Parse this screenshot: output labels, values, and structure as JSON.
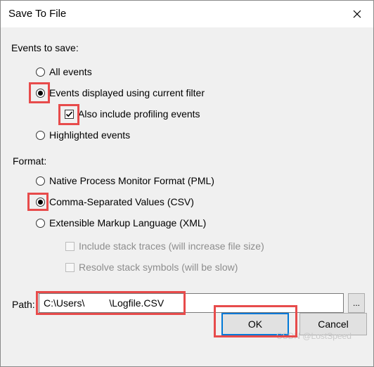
{
  "dialog": {
    "title": "Save To File"
  },
  "events_group": {
    "label": "Events to save:",
    "options": [
      {
        "label": "All events",
        "selected": false
      },
      {
        "label": "Events displayed using current filter",
        "selected": true
      },
      {
        "label": "Highlighted events",
        "selected": false
      }
    ],
    "profiling": {
      "label": "Also include profiling events",
      "checked": true
    }
  },
  "format_group": {
    "label": "Format:",
    "options": [
      {
        "label": "Native Process Monitor Format (PML)",
        "selected": false
      },
      {
        "label": "Comma-Separated Values (CSV)",
        "selected": true
      },
      {
        "label": "Extensible Markup Language (XML)",
        "selected": false
      }
    ],
    "xml_options": [
      {
        "label": "Include stack traces (will increase file size)",
        "checked": false,
        "enabled": false
      },
      {
        "label": "Resolve stack symbols (will be slow)",
        "checked": false,
        "enabled": false
      }
    ]
  },
  "path": {
    "label": "Path:",
    "value": "C:\\Users\\         \\Logfile.CSV",
    "browse_label": "..."
  },
  "buttons": {
    "ok": "OK",
    "cancel": "Cancel"
  },
  "watermark": "CSDN @LostSpeed",
  "colors": {
    "highlight": "#e74b4b",
    "default_button_border": "#0078d7"
  }
}
